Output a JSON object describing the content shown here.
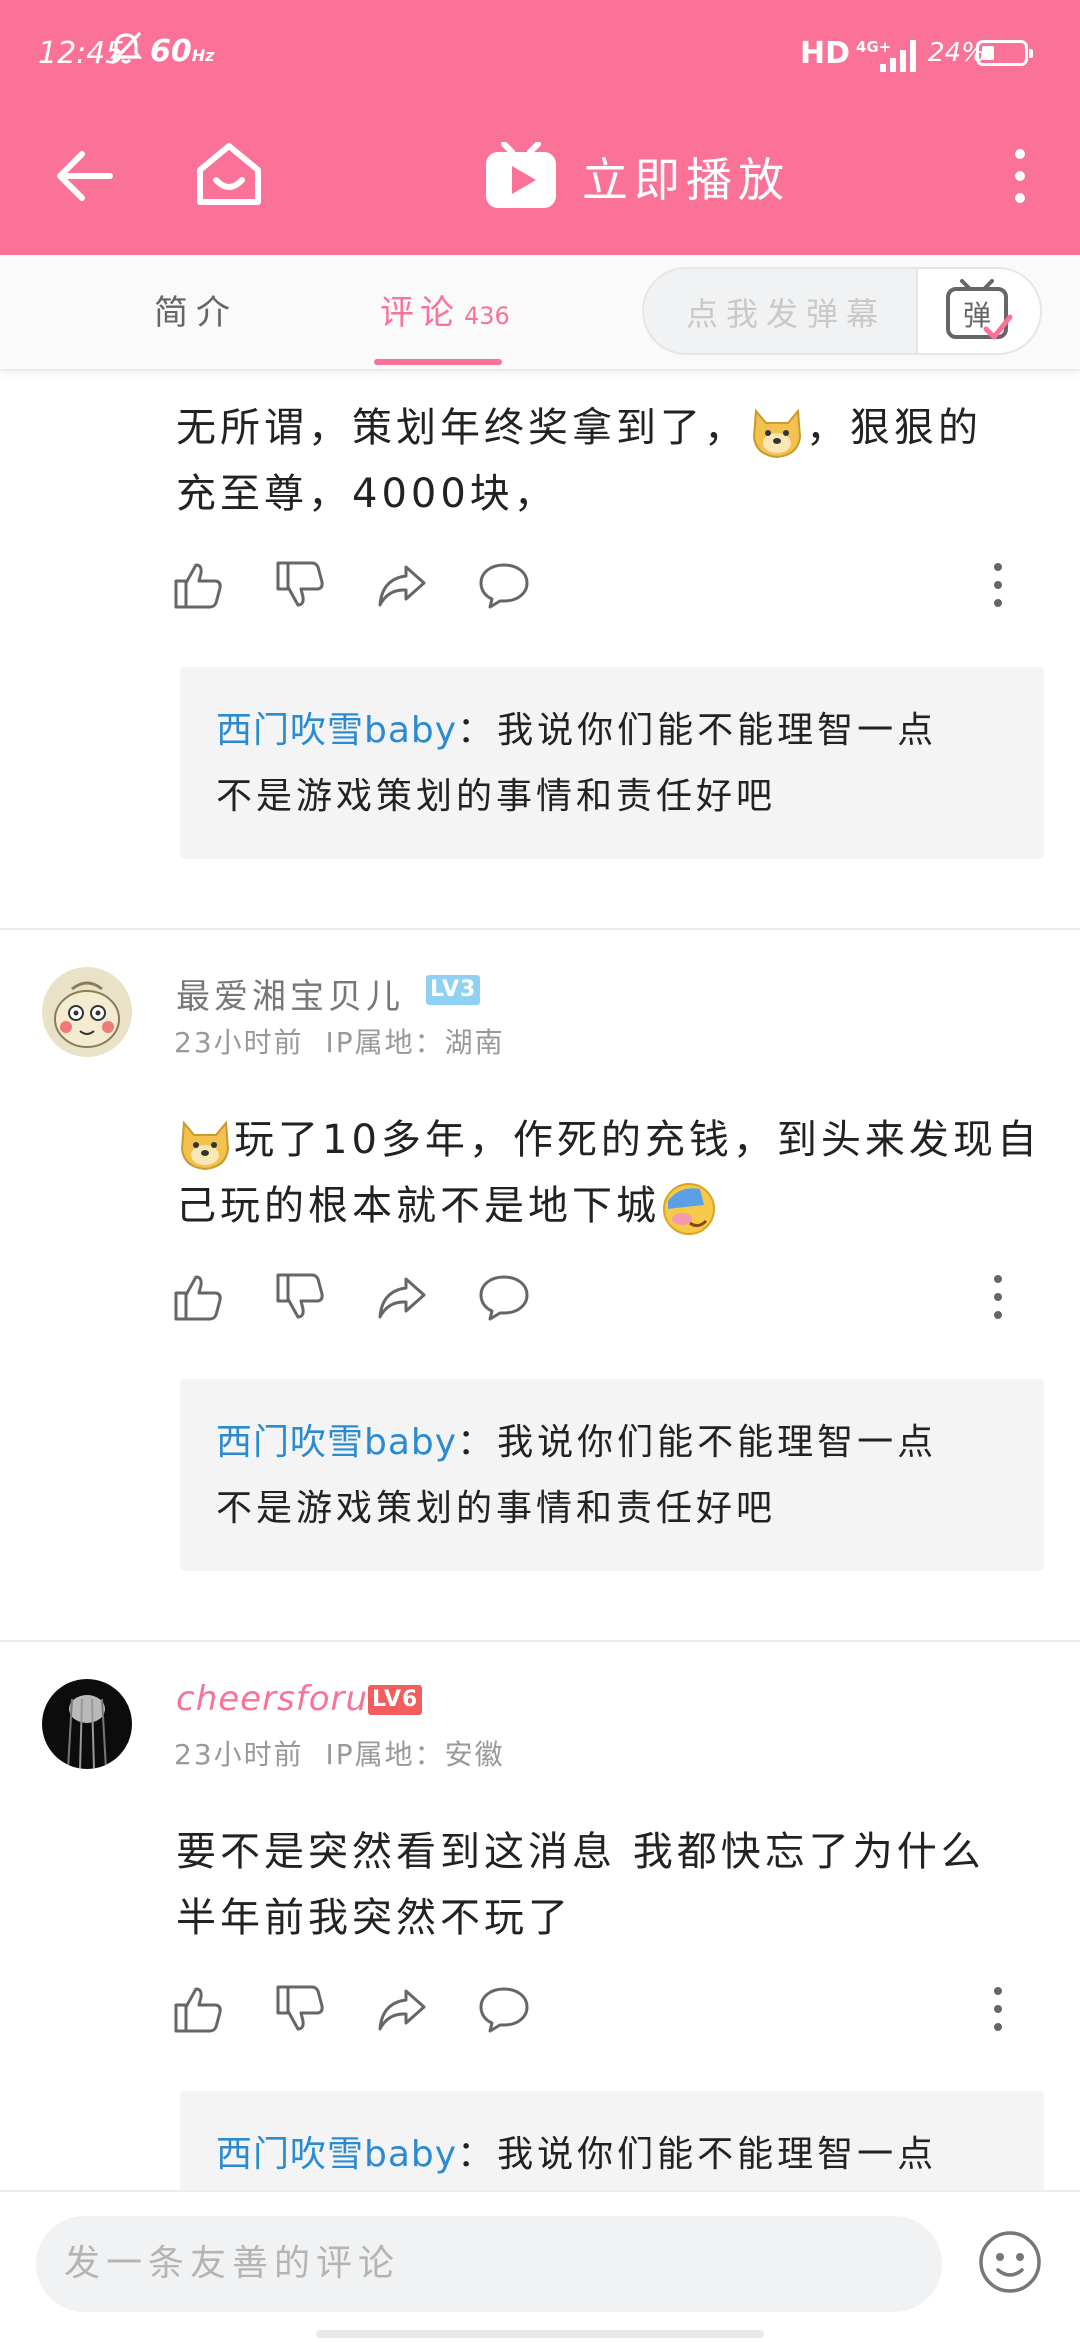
{
  "status_bar": {
    "time": "12:45",
    "refresh": "60",
    "refresh_unit": "Hz",
    "hd": "HD",
    "network": "4G+",
    "battery": "24%"
  },
  "app_bar": {
    "title": "立即播放",
    "icons": [
      "back-arrow-icon",
      "home-icon",
      "tv-play-icon",
      "more-vertical-icon"
    ]
  },
  "tabs": {
    "intro": "简介",
    "comments": "评论",
    "comments_count": "436",
    "danmaku_placeholder": "点我发弹幕",
    "danmaku_button": "弹"
  },
  "colors": {
    "brand": "#fb7299",
    "reply_author": "#2b8bd0",
    "vip_name": "#fb7299",
    "lv3": "#8fd1f2",
    "lv6": "#f25d5d"
  },
  "comments": [
    {
      "text_line1_a": "无所谓，策划年终奖拿到了，",
      "text_line1_b": "，狠狠的",
      "text_line2": "充至尊，4000块，",
      "reply_author": "西门吹雪baby",
      "reply_line1": "：我说你们能不能理智一点",
      "reply_line2": "不是游戏策划的事情和责任好吧"
    },
    {
      "user": "最爱湘宝贝儿",
      "level": "LV3",
      "time": "23小时前",
      "ip": "IP属地：湖南",
      "text_line1": "玩了10多年，作死的充钱，到头来发现自",
      "text_line2": "己玩的根本就不是地下城",
      "reply_author": "西门吹雪baby",
      "reply_line1": "：我说你们能不能理智一点",
      "reply_line2": "不是游戏策划的事情和责任好吧"
    },
    {
      "user": "cheersforuu",
      "level": "LV6",
      "time": "23小时前",
      "ip": "IP属地：安徽",
      "text_line1": "要不是突然看到这消息 我都快忘了为什么",
      "text_line2": "半年前我突然不玩了",
      "reply_author": "西门吹雪baby",
      "reply_line1": "：我说你们能不能理智一点"
    }
  ],
  "bottom_bar": {
    "placeholder": "发一条友善的评论"
  }
}
